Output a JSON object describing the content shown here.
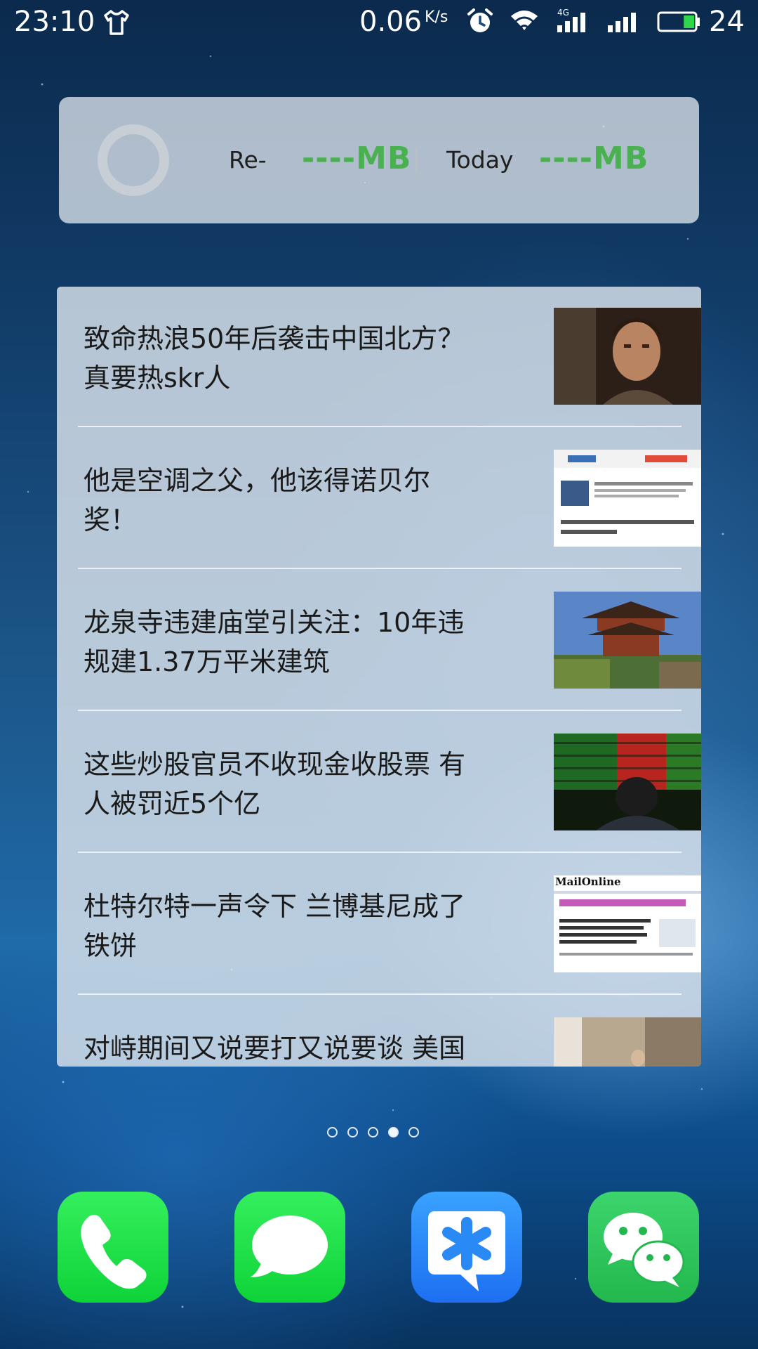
{
  "status_bar": {
    "time": "23:10",
    "net_speed": "0.06",
    "net_speed_unit": "K/s",
    "network_type": "4G",
    "battery_percent": "24",
    "battery_level": 0.24,
    "icons": [
      "tshirt-icon",
      "alarm-icon",
      "wifi-icon",
      "cellular-4g-icon",
      "cellular-signal-icon",
      "battery-icon"
    ]
  },
  "data_widget": {
    "remaining_label": "Re-",
    "remaining_value": "----MB",
    "today_label": "Today",
    "today_value": "----MB",
    "value_color": "#49b14f"
  },
  "news": {
    "items": [
      {
        "title_line1": "致命热浪50年后袭击中国北方？",
        "title_line2": "真要热skr人",
        "thumb": "man-portrait-thumb"
      },
      {
        "title_line1": "他是空调之父，他该得诺贝尔",
        "title_line2": "奖！",
        "thumb": "news-site-screenshot-thumb"
      },
      {
        "title_line1": "龙泉寺违建庙堂引关注：10年违",
        "title_line2": "规建1.37万平米建筑",
        "thumb": "temple-thumb"
      },
      {
        "title_line1": "这些炒股官员不收现金收股票 有",
        "title_line2": "人被罚近5个亿",
        "thumb": "stock-board-thumb"
      },
      {
        "title_line1": "杜特尔特一声令下 兰博基尼成了",
        "title_line2": "铁饼",
        "thumb": "mailonline-screenshot-thumb",
        "thumb_logo": "MailOnline"
      },
      {
        "title_line1": "对峙期间又说要打又说要谈 美国",
        "title_line2": "",
        "thumb": "office-photo-thumb"
      }
    ]
  },
  "page_indicator": {
    "total": 5,
    "active_index": 3
  },
  "dock": {
    "apps": [
      {
        "name": "phone",
        "icon": "phone-icon"
      },
      {
        "name": "messages",
        "icon": "message-bubble-icon"
      },
      {
        "name": "qq-mail",
        "icon": "asterisk-bubble-icon"
      },
      {
        "name": "wechat",
        "icon": "wechat-icon"
      }
    ]
  }
}
